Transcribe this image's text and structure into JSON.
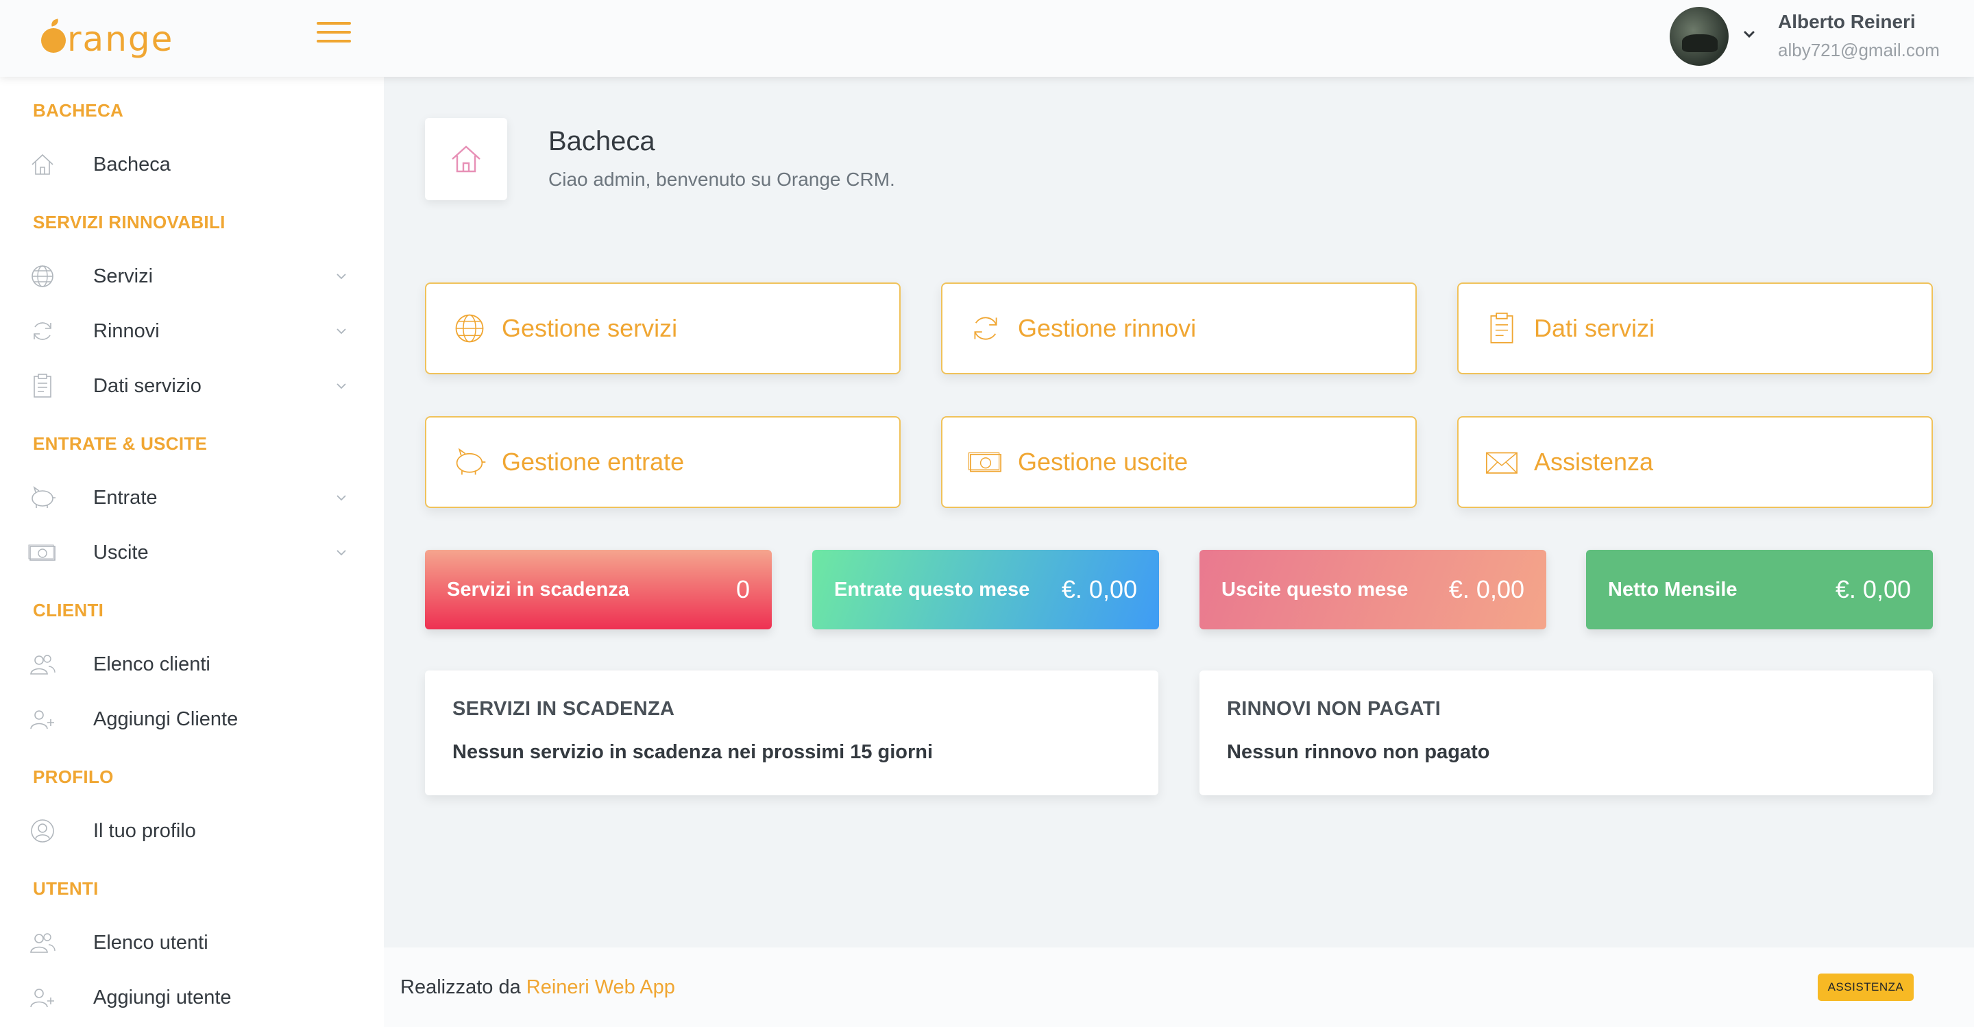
{
  "header": {
    "logo": "Orange",
    "user_name": "Alberto Reineri",
    "user_email": "alby721@gmail.com"
  },
  "sidebar": {
    "sections": [
      {
        "heading": "BACHECA",
        "items": [
          {
            "label": "Bacheca",
            "icon": "home-icon"
          }
        ]
      },
      {
        "heading": "SERVIZI RINNOVABILI",
        "items": [
          {
            "label": "Servizi",
            "icon": "globe-icon"
          },
          {
            "label": "Rinnovi",
            "icon": "refresh-icon"
          },
          {
            "label": "Dati servizio",
            "icon": "clipboard-icon"
          }
        ]
      },
      {
        "heading": "ENTRATE & USCITE",
        "items": [
          {
            "label": "Entrate",
            "icon": "piggy-bank-icon"
          },
          {
            "label": "Uscite",
            "icon": "cash-icon"
          }
        ]
      },
      {
        "heading": "CLIENTI",
        "items": [
          {
            "label": "Elenco clienti",
            "icon": "users-icon"
          },
          {
            "label": "Aggiungi Cliente",
            "icon": "user-add-icon"
          }
        ]
      },
      {
        "heading": "PROFILO",
        "items": [
          {
            "label": "Il tuo profilo",
            "icon": "user-icon"
          }
        ]
      },
      {
        "heading": "UTENTI",
        "items": [
          {
            "label": "Elenco utenti",
            "icon": "users-icon"
          },
          {
            "label": "Aggiungi utente",
            "icon": "user-add-icon"
          }
        ]
      }
    ]
  },
  "page": {
    "title": "Bacheca",
    "subtitle": "Ciao admin, benvenuto su Orange CRM."
  },
  "quick_links": [
    {
      "label": "Gestione servizi",
      "icon": "globe-icon"
    },
    {
      "label": "Gestione rinnovi",
      "icon": "refresh-icon"
    },
    {
      "label": "Dati servizi",
      "icon": "clipboard-icon"
    },
    {
      "label": "Gestione entrate",
      "icon": "piggy-bank-icon"
    },
    {
      "label": "Gestione uscite",
      "icon": "cash-icon"
    },
    {
      "label": "Assistenza",
      "icon": "envelope-icon"
    }
  ],
  "stats": [
    {
      "label": "Servizi in scadenza",
      "value": "0",
      "color_from": "#f5a58e",
      "color_to": "#ee3152"
    },
    {
      "label": "Entrate questo mese",
      "value": "€. 0,00",
      "color_from": "#6ee7a3",
      "color_to": "#3f9cf5"
    },
    {
      "label": "Uscite questo mese",
      "value": "€. 0,00",
      "color_from": "#e9798f",
      "color_to": "#f4a58a"
    },
    {
      "label": "Netto Mensile",
      "value": "€. 0,00",
      "color_from": "#5fbe7d",
      "color_to": "#5fbe7d"
    }
  ],
  "cards": [
    {
      "title": "SERVIZI IN SCADENZA",
      "message": "Nessun servizio in scadenza nei prossimi 15 giorni"
    },
    {
      "title": "RINNOVI NON PAGATI",
      "message": "Nessun rinnovo non pagato"
    }
  ],
  "footer": {
    "text": "Realizzato da",
    "link": "Reineri Web App",
    "button": "ASSISTENZA"
  },
  "colors": {
    "accent": "#f0a632",
    "text": "#343a40"
  }
}
